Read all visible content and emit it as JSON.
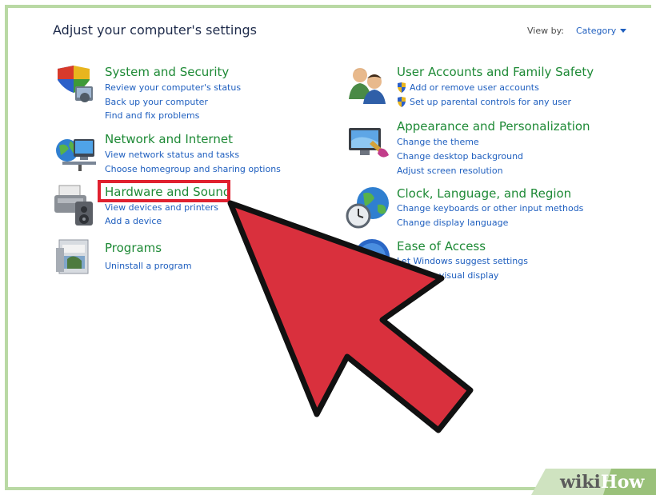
{
  "header": {
    "title": "Adjust your computer's settings",
    "view_by_label": "View by:",
    "view_by_value": "Category"
  },
  "categories": [
    {
      "title": "System and Security",
      "links": [
        "Review your computer's status",
        "Back up your computer",
        "Find and fix problems"
      ],
      "icon": "shield-computer-icon"
    },
    {
      "title": "Network and Internet",
      "links": [
        "View network status and tasks",
        "Choose homegroup and sharing options"
      ],
      "icon": "network-globe-icon"
    },
    {
      "title": "Hardware and Sound",
      "links": [
        "View devices and printers",
        "Add a device"
      ],
      "icon": "printer-speaker-icon"
    },
    {
      "title": "Programs",
      "links": [
        "Uninstall a program"
      ],
      "icon": "programs-icon"
    },
    {
      "title": "User Accounts and Family Safety",
      "links": [
        "Add or remove user accounts",
        "Set up parental controls for any user"
      ],
      "icon": "users-icon"
    },
    {
      "title": "Appearance and Personalization",
      "links": [
        "Change the theme",
        "Change desktop background",
        "Adjust screen resolution"
      ],
      "icon": "monitor-paint-icon"
    },
    {
      "title": "Clock, Language, and Region",
      "links": [
        "Change keyboards or other input methods",
        "Change display language"
      ],
      "icon": "clock-globe-icon"
    },
    {
      "title": "Ease of Access",
      "links": [
        "Let Windows suggest settings",
        "Optimize visual display"
      ],
      "icon": "ease-of-access-icon"
    }
  ],
  "overlay": {
    "arrow_color": "#d9303d",
    "highlight_color": "#e0212f"
  },
  "watermark": {
    "wiki": "wiki",
    "how": "How"
  }
}
